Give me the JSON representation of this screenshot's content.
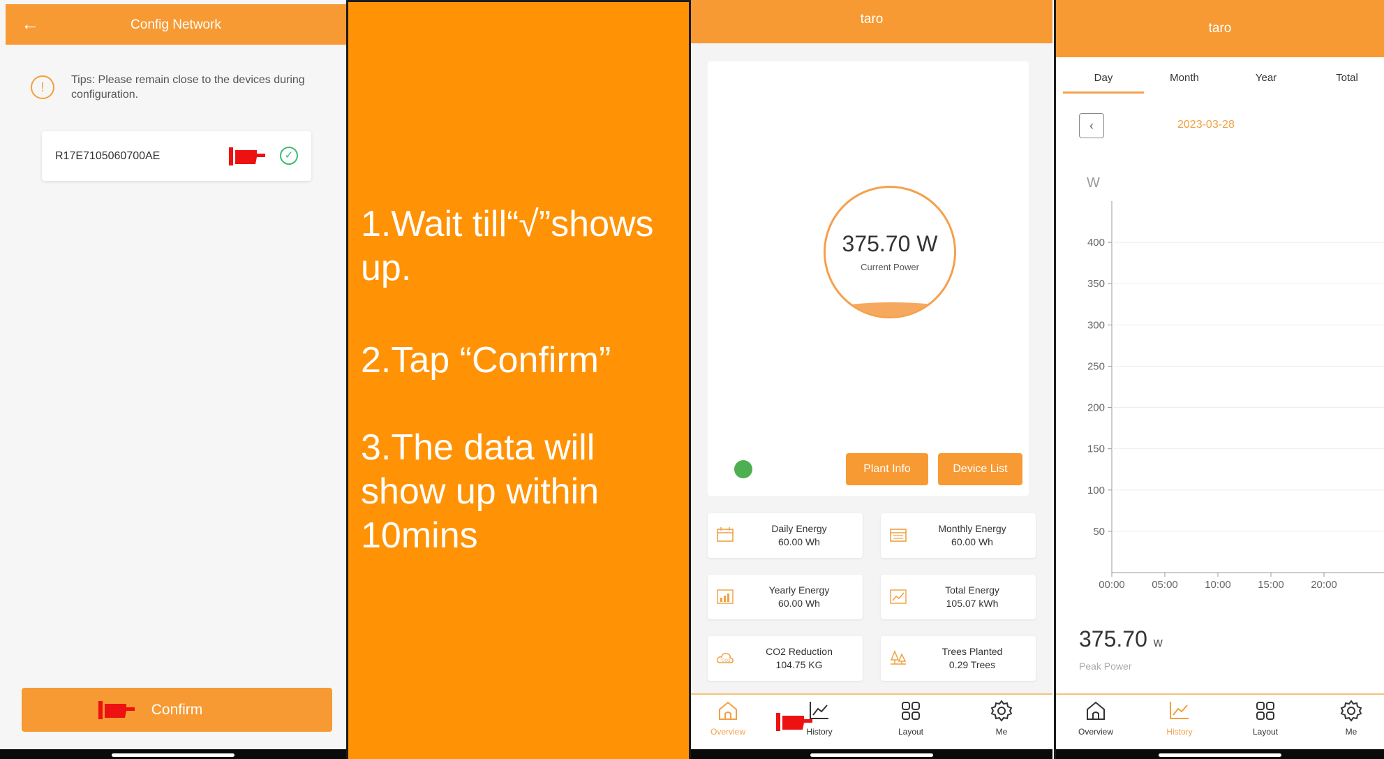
{
  "panel1": {
    "header": {
      "title": "Config Network"
    },
    "tip": {
      "text": "Tips: Please remain close to the devices during configuration.",
      "icon": "!"
    },
    "device": {
      "serial": "R17E7105060700AE",
      "status_icon": "✓"
    },
    "confirm_button": {
      "label": "Confirm"
    }
  },
  "instructions": {
    "step1": "1.Wait till“√”shows up.",
    "step2": "2.Tap “Confirm”",
    "step3": "3.The data will show up within 10mins"
  },
  "overview": {
    "header": {
      "title": "taro"
    },
    "current_power": {
      "value": "375.70 W",
      "label": "Current Power"
    },
    "buttons": {
      "plant_info": "Plant Info",
      "device_list": "Device List"
    },
    "stats": [
      {
        "title": "Daily Energy",
        "value": "60.00 Wh"
      },
      {
        "title": "Monthly Energy",
        "value": "60.00 Wh"
      },
      {
        "title": "Yearly Energy",
        "value": "60.00 Wh"
      },
      {
        "title": "Total Energy",
        "value": "105.07 kWh"
      },
      {
        "title": "CO2 Reduction",
        "value": "104.75 KG"
      },
      {
        "title": "Trees Planted",
        "value": "0.29 Trees"
      }
    ],
    "tabs": [
      {
        "label": "Overview",
        "active": true
      },
      {
        "label": "History",
        "active": false
      },
      {
        "label": "Layout",
        "active": false
      },
      {
        "label": "Me",
        "active": false
      }
    ]
  },
  "history": {
    "header": {
      "title": "taro"
    },
    "periods": [
      "Day",
      "Month",
      "Year",
      "Total"
    ],
    "date": "2023-03-28",
    "peak": {
      "value": "375.70",
      "unit": "w",
      "label": "Peak Power"
    },
    "tabs": [
      {
        "label": "Overview",
        "active": false
      },
      {
        "label": "History",
        "active": true
      },
      {
        "label": "Layout",
        "active": false
      },
      {
        "label": "Me",
        "active": false
      }
    ]
  },
  "chart_data": {
    "type": "line",
    "title": "",
    "xlabel": "",
    "ylabel": "W",
    "categories": [
      "00:00",
      "05:00",
      "10:00",
      "15:00",
      "20:00"
    ],
    "yticks": [
      50,
      100,
      150,
      200,
      250,
      300,
      350,
      400
    ],
    "ylim": [
      0,
      450
    ],
    "series": [],
    "grid": true
  },
  "colors": {
    "accent": "#f79a33",
    "instruction_bg": "#ff9205",
    "success": "#3dbb74",
    "status_dot": "#4caf50",
    "pointer": "#ee1111"
  }
}
